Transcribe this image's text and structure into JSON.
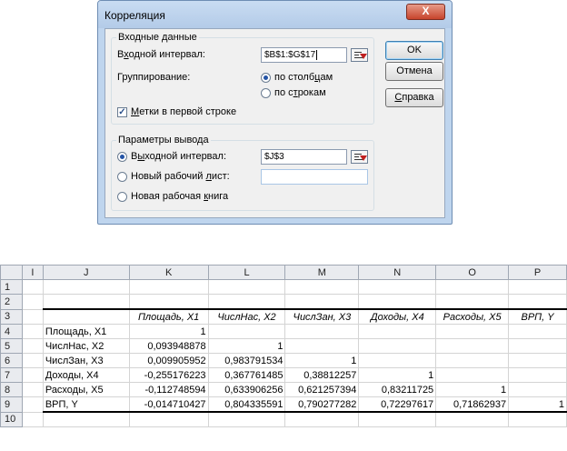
{
  "dialog": {
    "title": "Корреляция",
    "close_glyph": "X",
    "input_group": {
      "legend": "Входные данные",
      "input_range_label_pre": "В",
      "input_range_label_u": "х",
      "input_range_label_post": "одной интервал:",
      "input_range_value": "$B$1:$G$17",
      "grouping_label": "Группирование:",
      "by_columns_pre": "по столб",
      "by_columns_u": "ц",
      "by_columns_post": "ам",
      "by_rows_pre": "по с",
      "by_rows_u": "т",
      "by_rows_post": "рокам",
      "labels_pre": "",
      "labels_u": "М",
      "labels_post": "етки в первой строке"
    },
    "output_group": {
      "legend": "Параметры вывода",
      "output_range_pre": "В",
      "output_range_u": "ы",
      "output_range_post": "ходной интервал:",
      "output_range_value": "$J$3",
      "new_sheet_pre": "Новый рабочий ",
      "new_sheet_u": "л",
      "new_sheet_post": "ист:",
      "new_sheet_value": "",
      "new_book_pre": "Новая рабочая ",
      "new_book_u": "к",
      "new_book_post": "нига"
    },
    "buttons": {
      "ok": "OK",
      "cancel": "Отмена",
      "help_pre": "",
      "help_u": "С",
      "help_post": "правка"
    },
    "state": {
      "grouping": "columns",
      "labels_first_row": true,
      "output_option": "output_range"
    }
  },
  "sheet": {
    "columns": [
      "I",
      "J",
      "K",
      "L",
      "M",
      "N",
      "O",
      "P"
    ],
    "rows": [
      {
        "num": "1",
        "cells": [
          "",
          "",
          "",
          "",
          "",
          "",
          "",
          ""
        ]
      },
      {
        "num": "2",
        "cells": [
          "",
          "",
          "",
          "",
          "",
          "",
          "",
          ""
        ]
      },
      {
        "num": "3",
        "cells": [
          "",
          "",
          "Площадь, X1",
          "ЧислНас, X2",
          "ЧислЗан, X3",
          "Доходы, X4",
          "Расходы, X5",
          "ВРП, Y"
        ]
      },
      {
        "num": "4",
        "cells": [
          "",
          "Площадь, X1",
          "1",
          "",
          "",
          "",
          "",
          ""
        ]
      },
      {
        "num": "5",
        "cells": [
          "",
          "ЧислНас, X2",
          "0,093948878",
          "1",
          "",
          "",
          "",
          ""
        ]
      },
      {
        "num": "6",
        "cells": [
          "",
          "ЧислЗан, X3",
          "0,009905952",
          "0,983791534",
          "1",
          "",
          "",
          ""
        ]
      },
      {
        "num": "7",
        "cells": [
          "",
          "Доходы, X4",
          "-0,255176223",
          "0,367761485",
          "0,38812257",
          "1",
          "",
          ""
        ]
      },
      {
        "num": "8",
        "cells": [
          "",
          "Расходы, X5",
          "-0,112748594",
          "0,633906256",
          "0,621257394",
          "0,83211725",
          "1",
          ""
        ]
      },
      {
        "num": "9",
        "cells": [
          "",
          "ВРП, Y",
          "-0,014710427",
          "0,804335591",
          "0,790277282",
          "0,72297617",
          "0,71862937",
          "1"
        ]
      },
      {
        "num": "10",
        "cells": [
          "",
          "",
          "",
          "",
          "",
          "",
          "",
          ""
        ]
      }
    ]
  }
}
